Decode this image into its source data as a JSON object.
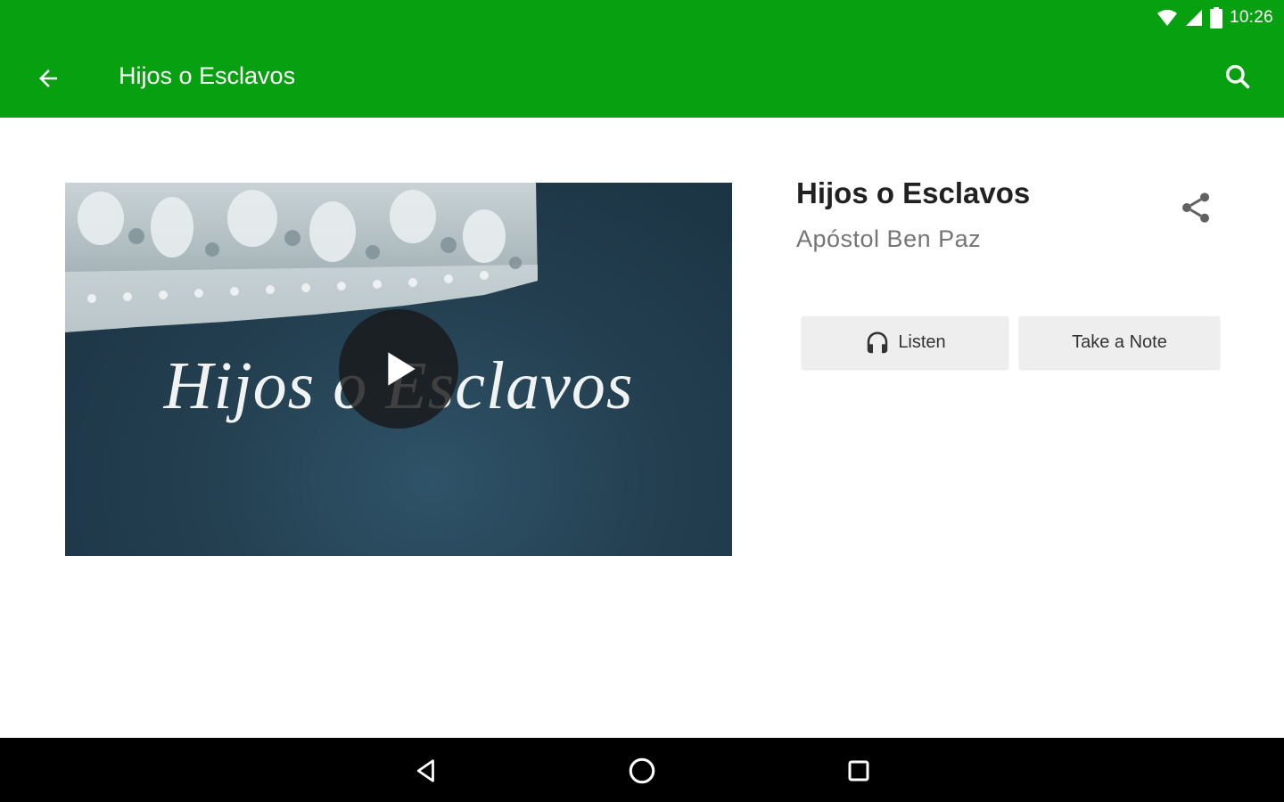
{
  "status_bar": {
    "time": "10:26",
    "icons": [
      "wifi-icon",
      "cell-signal-icon",
      "battery-icon"
    ]
  },
  "toolbar": {
    "title": "Hijos o Esclavos",
    "back_icon": "arrow-back-icon",
    "search_icon": "search-icon",
    "color": "#06a010"
  },
  "media": {
    "thumbnail_caption": "Hijos o Esclavos",
    "play_icon": "play-icon"
  },
  "details": {
    "title": "Hijos o Esclavos",
    "speaker": "Apóstol Ben Paz",
    "share_icon": "share-icon"
  },
  "actions": {
    "listen_label": "Listen",
    "listen_icon": "headphones-icon",
    "note_label": "Take a Note"
  },
  "navigation_bar": {
    "icons": [
      "nav-back-icon",
      "nav-home-icon",
      "nav-recents-icon"
    ]
  }
}
